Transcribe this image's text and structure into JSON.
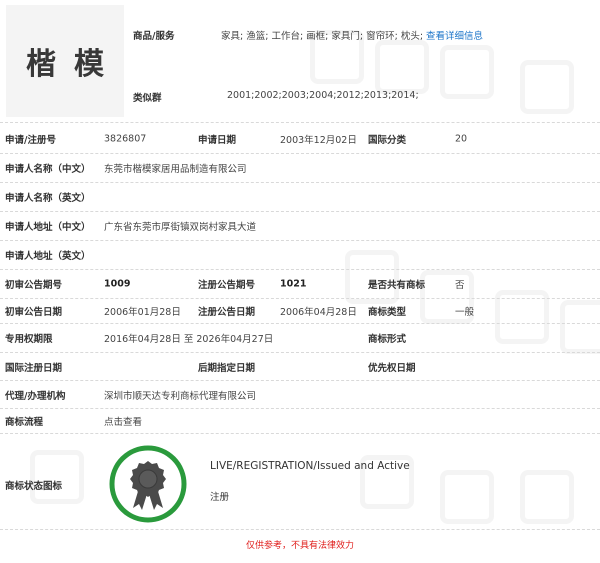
{
  "header": {
    "logo_text": "楷模",
    "goods_label": "商品/服务",
    "goods_value": "家具; 渔篮; 工作台; 画框; 家具门; 窗帘环; 枕头;",
    "goods_link": "查看详细信息",
    "similar_label": "类似群",
    "similar_value": "2001;2002;2003;2004;2012;2013;2014;"
  },
  "rows": {
    "app_no_label": "申请/注册号",
    "app_no": "3826807",
    "app_date_label": "申请日期",
    "app_date": "2003年12月02日",
    "intl_class_label": "国际分类",
    "intl_class": "20",
    "name_cn_label": "申请人名称（中文）",
    "name_cn": "东莞市楷模家居用品制造有限公司",
    "name_en_label": "申请人名称（英文）",
    "addr_cn_label": "申请人地址（中文）",
    "addr_cn": "广东省东莞市厚街镇双岗村家具大道",
    "addr_en_label": "申请人地址（英文）",
    "prelim_no_label": "初审公告期号",
    "prelim_no": "1009",
    "reg_no_label": "注册公告期号",
    "reg_no": "1021",
    "shared_label": "是否共有商标",
    "shared": "否",
    "prelim_date_label": "初审公告日期",
    "prelim_date": "2006年01月28日",
    "reg_date_label": "注册公告日期",
    "reg_date": "2006年04月28日",
    "type_label": "商标类型",
    "type": "一般",
    "period_label": "专用权期限",
    "period": "2016年04月28日 至 2026年04月27日",
    "form_label": "商标形式",
    "intl_reg_label": "国际注册日期",
    "later_label": "后期指定日期",
    "priority_label": "优先权日期",
    "agent_label": "代理/办理机构",
    "agent": "深圳市顺天达专利商标代理有限公司",
    "flow_label": "商标流程",
    "flow_link": "点击查看",
    "status_label": "商标状态图标",
    "status_en": "LIVE/REGISTRATION/Issued and Active",
    "status_cn": "注册"
  },
  "notice": "仅供参考，不具有法律效力",
  "colors": {
    "link": "#1a73c8",
    "badge_ring": "#2a9a3c",
    "notice": "#e0201e"
  }
}
